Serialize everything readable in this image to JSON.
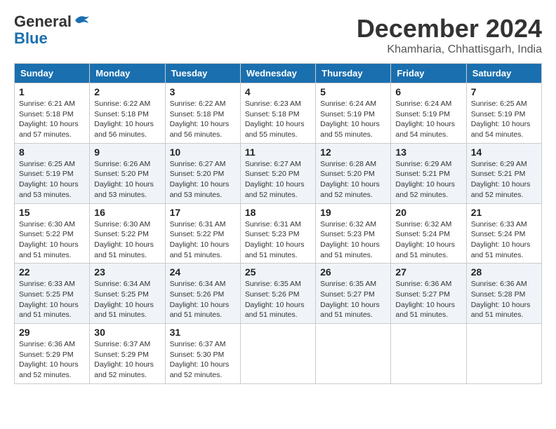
{
  "logo": {
    "line1": "General",
    "line2": "Blue"
  },
  "title": "December 2024",
  "location": "Khamharia, Chhattisgarh, India",
  "days_of_week": [
    "Sunday",
    "Monday",
    "Tuesday",
    "Wednesday",
    "Thursday",
    "Friday",
    "Saturday"
  ],
  "weeks": [
    [
      {
        "day": "1",
        "sunrise": "6:21 AM",
        "sunset": "5:18 PM",
        "daylight": "10 hours and 57 minutes."
      },
      {
        "day": "2",
        "sunrise": "6:22 AM",
        "sunset": "5:18 PM",
        "daylight": "10 hours and 56 minutes."
      },
      {
        "day": "3",
        "sunrise": "6:22 AM",
        "sunset": "5:18 PM",
        "daylight": "10 hours and 56 minutes."
      },
      {
        "day": "4",
        "sunrise": "6:23 AM",
        "sunset": "5:18 PM",
        "daylight": "10 hours and 55 minutes."
      },
      {
        "day": "5",
        "sunrise": "6:24 AM",
        "sunset": "5:19 PM",
        "daylight": "10 hours and 55 minutes."
      },
      {
        "day": "6",
        "sunrise": "6:24 AM",
        "sunset": "5:19 PM",
        "daylight": "10 hours and 54 minutes."
      },
      {
        "day": "7",
        "sunrise": "6:25 AM",
        "sunset": "5:19 PM",
        "daylight": "10 hours and 54 minutes."
      }
    ],
    [
      {
        "day": "8",
        "sunrise": "6:25 AM",
        "sunset": "5:19 PM",
        "daylight": "10 hours and 53 minutes."
      },
      {
        "day": "9",
        "sunrise": "6:26 AM",
        "sunset": "5:20 PM",
        "daylight": "10 hours and 53 minutes."
      },
      {
        "day": "10",
        "sunrise": "6:27 AM",
        "sunset": "5:20 PM",
        "daylight": "10 hours and 53 minutes."
      },
      {
        "day": "11",
        "sunrise": "6:27 AM",
        "sunset": "5:20 PM",
        "daylight": "10 hours and 52 minutes."
      },
      {
        "day": "12",
        "sunrise": "6:28 AM",
        "sunset": "5:20 PM",
        "daylight": "10 hours and 52 minutes."
      },
      {
        "day": "13",
        "sunrise": "6:29 AM",
        "sunset": "5:21 PM",
        "daylight": "10 hours and 52 minutes."
      },
      {
        "day": "14",
        "sunrise": "6:29 AM",
        "sunset": "5:21 PM",
        "daylight": "10 hours and 52 minutes."
      }
    ],
    [
      {
        "day": "15",
        "sunrise": "6:30 AM",
        "sunset": "5:22 PM",
        "daylight": "10 hours and 51 minutes."
      },
      {
        "day": "16",
        "sunrise": "6:30 AM",
        "sunset": "5:22 PM",
        "daylight": "10 hours and 51 minutes."
      },
      {
        "day": "17",
        "sunrise": "6:31 AM",
        "sunset": "5:22 PM",
        "daylight": "10 hours and 51 minutes."
      },
      {
        "day": "18",
        "sunrise": "6:31 AM",
        "sunset": "5:23 PM",
        "daylight": "10 hours and 51 minutes."
      },
      {
        "day": "19",
        "sunrise": "6:32 AM",
        "sunset": "5:23 PM",
        "daylight": "10 hours and 51 minutes."
      },
      {
        "day": "20",
        "sunrise": "6:32 AM",
        "sunset": "5:24 PM",
        "daylight": "10 hours and 51 minutes."
      },
      {
        "day": "21",
        "sunrise": "6:33 AM",
        "sunset": "5:24 PM",
        "daylight": "10 hours and 51 minutes."
      }
    ],
    [
      {
        "day": "22",
        "sunrise": "6:33 AM",
        "sunset": "5:25 PM",
        "daylight": "10 hours and 51 minutes."
      },
      {
        "day": "23",
        "sunrise": "6:34 AM",
        "sunset": "5:25 PM",
        "daylight": "10 hours and 51 minutes."
      },
      {
        "day": "24",
        "sunrise": "6:34 AM",
        "sunset": "5:26 PM",
        "daylight": "10 hours and 51 minutes."
      },
      {
        "day": "25",
        "sunrise": "6:35 AM",
        "sunset": "5:26 PM",
        "daylight": "10 hours and 51 minutes."
      },
      {
        "day": "26",
        "sunrise": "6:35 AM",
        "sunset": "5:27 PM",
        "daylight": "10 hours and 51 minutes."
      },
      {
        "day": "27",
        "sunrise": "6:36 AM",
        "sunset": "5:27 PM",
        "daylight": "10 hours and 51 minutes."
      },
      {
        "day": "28",
        "sunrise": "6:36 AM",
        "sunset": "5:28 PM",
        "daylight": "10 hours and 51 minutes."
      }
    ],
    [
      {
        "day": "29",
        "sunrise": "6:36 AM",
        "sunset": "5:29 PM",
        "daylight": "10 hours and 52 minutes."
      },
      {
        "day": "30",
        "sunrise": "6:37 AM",
        "sunset": "5:29 PM",
        "daylight": "10 hours and 52 minutes."
      },
      {
        "day": "31",
        "sunrise": "6:37 AM",
        "sunset": "5:30 PM",
        "daylight": "10 hours and 52 minutes."
      },
      null,
      null,
      null,
      null
    ]
  ]
}
